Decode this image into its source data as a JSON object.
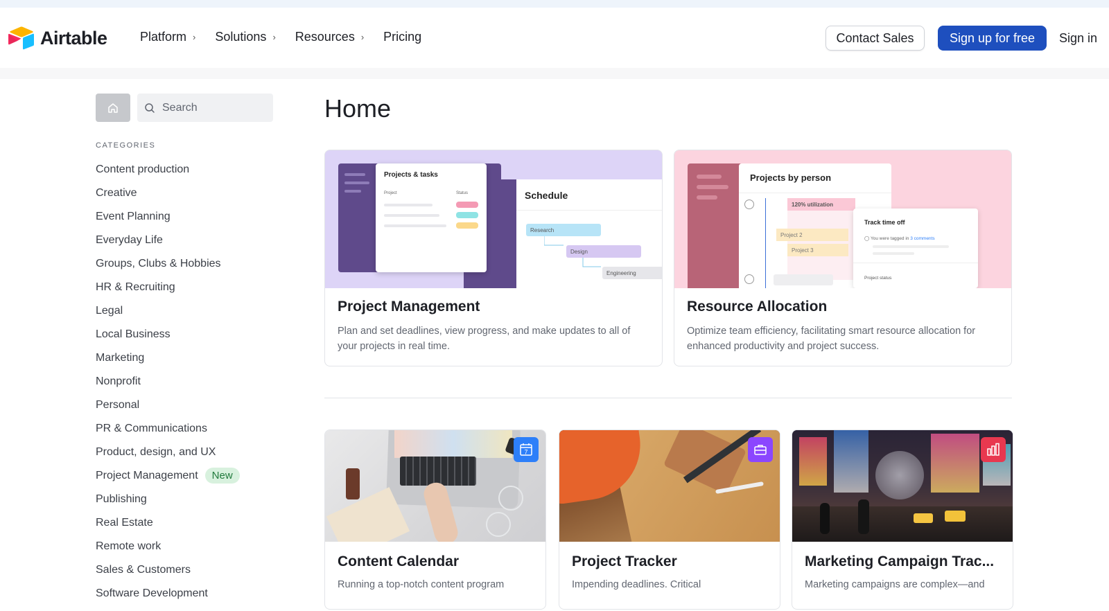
{
  "brand": {
    "name": "Airtable"
  },
  "nav": {
    "items": [
      {
        "label": "Platform",
        "has_chevron": true
      },
      {
        "label": "Solutions",
        "has_chevron": true
      },
      {
        "label": "Resources",
        "has_chevron": true
      },
      {
        "label": "Pricing",
        "has_chevron": false
      }
    ],
    "contact_sales": "Contact Sales",
    "sign_up": "Sign up for free",
    "sign_in": "Sign in"
  },
  "sidebar": {
    "search_placeholder": "Search",
    "categories_heading": "CATEGORIES",
    "categories": [
      {
        "label": "Content production"
      },
      {
        "label": "Creative"
      },
      {
        "label": "Event Planning"
      },
      {
        "label": "Everyday Life"
      },
      {
        "label": "Groups, Clubs & Hobbies"
      },
      {
        "label": "HR & Recruiting"
      },
      {
        "label": "Legal"
      },
      {
        "label": "Local Business"
      },
      {
        "label": "Marketing"
      },
      {
        "label": "Nonprofit"
      },
      {
        "label": "Personal"
      },
      {
        "label": "PR & Communications"
      },
      {
        "label": "Product, design, and UX"
      },
      {
        "label": "Project Management",
        "badge": "New"
      },
      {
        "label": "Publishing"
      },
      {
        "label": "Real Estate"
      },
      {
        "label": "Remote work"
      },
      {
        "label": "Sales & Customers"
      },
      {
        "label": "Software Development"
      }
    ]
  },
  "main": {
    "title": "Home",
    "featured": [
      {
        "title": "Project Management",
        "description": "Plan and set deadlines, view progress, and make updates to all of your projects in real time.",
        "art": {
          "panel_title": "Projects & tasks",
          "col_project": "Project",
          "col_status": "Status",
          "schedule_title": "Schedule",
          "steps": [
            "Research",
            "Design",
            "Engineering"
          ]
        }
      },
      {
        "title": "Resource Allocation",
        "description": "Optimize team efficiency, facilitating smart resource allocation for enhanced productivity and project success.",
        "art": {
          "panel_title": "Projects by person",
          "utilization": "120% utilization",
          "project2": "Project 2",
          "project3": "Project 3",
          "track_title": "Track time off",
          "tagged_prefix": "You were tagged in ",
          "tagged_link": "3 comments",
          "project_status": "Project status"
        }
      }
    ],
    "templates": [
      {
        "title": "Content Calendar",
        "description": "Running a top-notch content program",
        "icon": "calendar-icon",
        "icon_text": "7",
        "icon_color": "#2d7ff9"
      },
      {
        "title": "Project Tracker",
        "description": "Impending deadlines. Critical",
        "icon": "briefcase-icon",
        "icon_color": "#8b46ff"
      },
      {
        "title": "Marketing Campaign Trac...",
        "description": "Marketing campaigns are complex—and",
        "icon": "bar-chart-icon",
        "icon_color": "#e8384f"
      }
    ]
  }
}
